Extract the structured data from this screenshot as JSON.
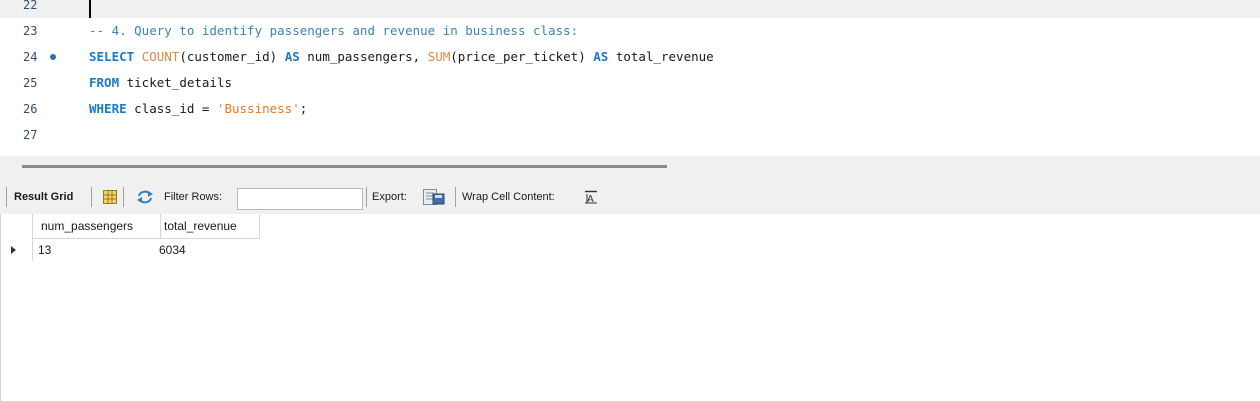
{
  "editor": {
    "lines": [
      {
        "num": "22",
        "tokens": []
      },
      {
        "num": "23",
        "tokens": [
          {
            "t": "-- 4. Query to identify passengers and revenue in business class:",
            "c": "cm"
          }
        ]
      },
      {
        "num": "24",
        "tokens": [
          {
            "t": "SELECT",
            "c": "kw"
          },
          {
            "t": " ",
            "c": ""
          },
          {
            "t": "COUNT",
            "c": "fn"
          },
          {
            "t": "(customer_id) ",
            "c": ""
          },
          {
            "t": "AS",
            "c": "kw"
          },
          {
            "t": " num_passengers, ",
            "c": ""
          },
          {
            "t": "SUM",
            "c": "fn"
          },
          {
            "t": "(price_per_ticket) ",
            "c": ""
          },
          {
            "t": "AS",
            "c": "kw"
          },
          {
            "t": " total_revenue",
            "c": ""
          }
        ]
      },
      {
        "num": "25",
        "tokens": [
          {
            "t": "FROM",
            "c": "kw"
          },
          {
            "t": " ticket_details",
            "c": ""
          }
        ]
      },
      {
        "num": "26",
        "tokens": [
          {
            "t": "WHERE",
            "c": "kw"
          },
          {
            "t": " class_id = ",
            "c": ""
          },
          {
            "t": "'Bussiness'",
            "c": "str"
          },
          {
            "t": ";",
            "c": ""
          }
        ]
      },
      {
        "num": "27",
        "tokens": []
      }
    ]
  },
  "toolbar": {
    "result_grid_label": "Result Grid",
    "filter_label": "Filter Rows:",
    "filter_value": "",
    "export_label": "Export:",
    "wrap_label": "Wrap Cell Content:",
    "grid_icon": "grid-icon",
    "refresh_icon": "refresh-icon",
    "export_icon": "export-icon",
    "wrap_icon": "wrap-icon"
  },
  "grid": {
    "columns": [
      "num_passengers",
      "total_revenue"
    ],
    "rows": [
      [
        "13",
        "6034"
      ]
    ]
  },
  "colors": {
    "keyword": "#1c7ac8",
    "function": "#d98a4a",
    "string": "#e8791f",
    "comment": "#3a84b6"
  }
}
